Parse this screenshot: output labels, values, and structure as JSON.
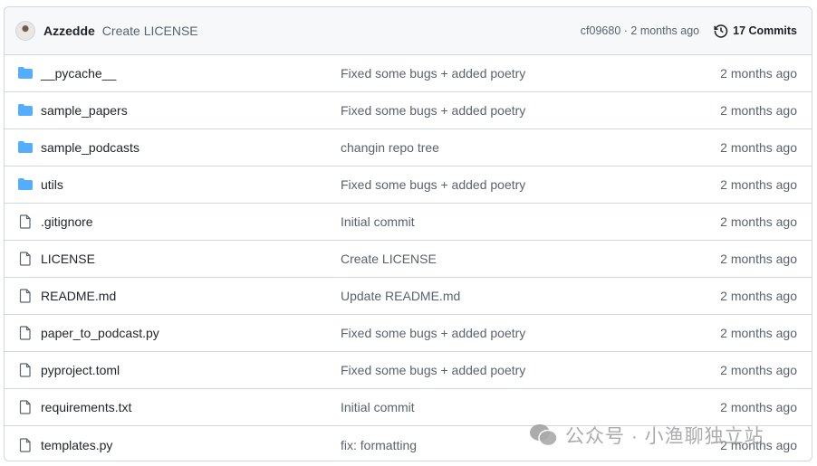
{
  "latest_commit": {
    "author": "Azzedde",
    "message": "Create LICENSE",
    "sha_time": "cf09680 · 2 months ago",
    "commits_label": "17 Commits"
  },
  "files": [
    {
      "type": "folder",
      "name": "__pycache__",
      "commit": "Fixed some bugs + added poetry",
      "age": "2 months ago"
    },
    {
      "type": "folder",
      "name": "sample_papers",
      "commit": "Fixed some bugs + added poetry",
      "age": "2 months ago"
    },
    {
      "type": "folder",
      "name": "sample_podcasts",
      "commit": "changin repo tree",
      "age": "2 months ago"
    },
    {
      "type": "folder",
      "name": "utils",
      "commit": "Fixed some bugs + added poetry",
      "age": "2 months ago"
    },
    {
      "type": "file",
      "name": ".gitignore",
      "commit": "Initial commit",
      "age": "2 months ago"
    },
    {
      "type": "file",
      "name": "LICENSE",
      "commit": "Create LICENSE",
      "age": "2 months ago"
    },
    {
      "type": "file",
      "name": "README.md",
      "commit": "Update README.md",
      "age": "2 months ago"
    },
    {
      "type": "file",
      "name": "paper_to_podcast.py",
      "commit": "Fixed some bugs + added poetry",
      "age": "2 months ago"
    },
    {
      "type": "file",
      "name": "pyproject.toml",
      "commit": "Fixed some bugs + added poetry",
      "age": "2 months ago"
    },
    {
      "type": "file",
      "name": "requirements.txt",
      "commit": "Initial commit",
      "age": "2 months ago"
    },
    {
      "type": "file",
      "name": "templates.py",
      "commit": "fix: formatting",
      "age": "2 months ago"
    }
  ],
  "colors": {
    "folder": "#54aeff",
    "file": "#59636e"
  },
  "watermark": "公众号 · 小渔聊独立站"
}
